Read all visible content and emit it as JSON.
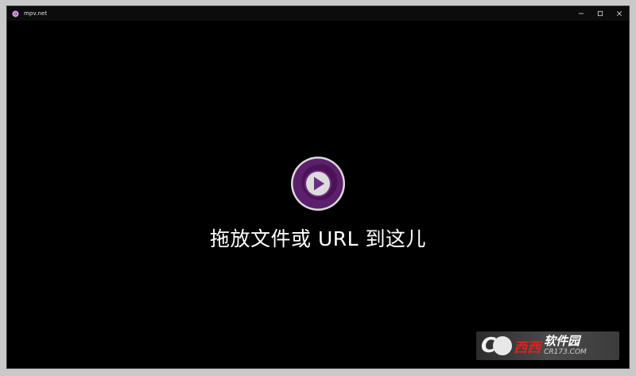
{
  "window": {
    "title": "mpv.net",
    "app_icon": "mpv-logo-icon",
    "controls": {
      "minimize_icon": "minimize-icon",
      "maximize_icon": "maximize-icon",
      "close_icon": "close-icon"
    }
  },
  "content": {
    "logo_icon": "mpv-play-logo-icon",
    "drop_text": "拖放文件或 URL 到这儿"
  },
  "watermark": {
    "c_letter": "C",
    "red_text": "西西",
    "name": "软件园",
    "url": "CR173.COM"
  },
  "colors": {
    "background": "#000000",
    "titlebar": "#0c0c0c",
    "logo_outer": "#5c1f6b",
    "logo_ring": "#ffffff",
    "logo_inner": "#6d2c82",
    "text": "#ffffff",
    "watermark_red": "#e02020"
  }
}
